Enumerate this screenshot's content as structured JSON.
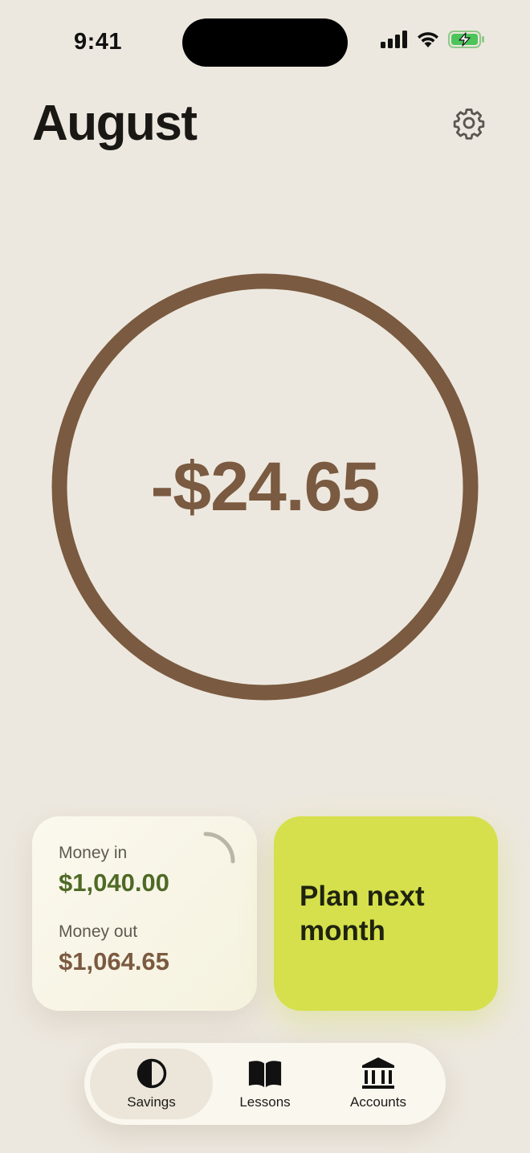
{
  "status_bar": {
    "time": "9:41",
    "icons": [
      "cellular-signal-icon",
      "wifi-icon",
      "battery-charging-icon"
    ]
  },
  "header": {
    "title": "August",
    "settings_icon": "gear-icon"
  },
  "balance": {
    "amount": "-$24.65",
    "ring_color": "#7a5a40"
  },
  "summary_card": {
    "money_in_label": "Money in",
    "money_in_value": "$1,040.00",
    "money_out_label": "Money out",
    "money_out_value": "$1,064.65",
    "in_color": "#4e6a26",
    "out_color": "#7a5a40"
  },
  "plan_card": {
    "label": "Plan next month",
    "color": "#d5e04c"
  },
  "tab_bar": {
    "tabs": [
      {
        "label": "Savings",
        "icon": "half-circle-icon",
        "active": true
      },
      {
        "label": "Lessons",
        "icon": "open-book-icon",
        "active": false
      },
      {
        "label": "Accounts",
        "icon": "bank-icon",
        "active": false
      }
    ]
  }
}
